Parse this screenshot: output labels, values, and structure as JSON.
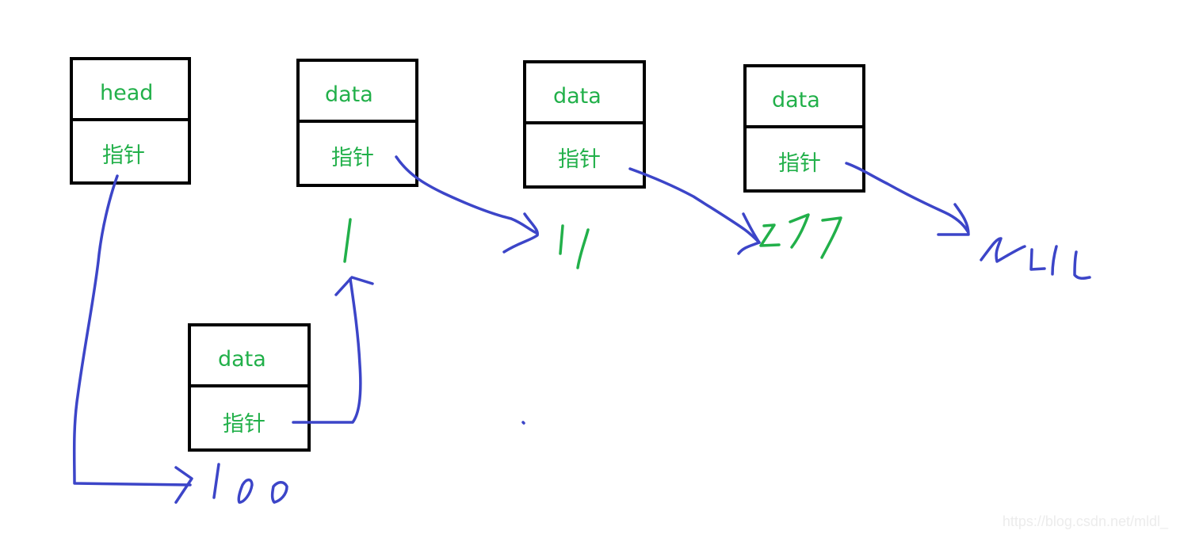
{
  "nodes": [
    {
      "id": "head",
      "top_label": "head",
      "bottom_label": "指针"
    },
    {
      "id": "node-1",
      "top_label": "data",
      "bottom_label": "指针"
    },
    {
      "id": "node-11",
      "top_label": "data",
      "bottom_label": "指针"
    },
    {
      "id": "node-277",
      "top_label": "data",
      "bottom_label": "指针"
    },
    {
      "id": "node-100",
      "top_label": "data",
      "bottom_label": "指针"
    }
  ],
  "addresses": {
    "a100": "100",
    "a1": "1",
    "a11": "11",
    "a277": "277",
    "null": "null"
  },
  "edges": [
    {
      "from": "head",
      "to": "100"
    },
    {
      "from": "node-100",
      "to": "1"
    },
    {
      "from": "node-1",
      "to": "11"
    },
    {
      "from": "node-11",
      "to": "277"
    },
    {
      "from": "node-277",
      "to": "null"
    }
  ],
  "colors": {
    "box_border": "#000000",
    "label_text": "#22b04a",
    "arrow_ink": "#3c45c8"
  },
  "watermark": "https://blog.csdn.net/mldl_"
}
